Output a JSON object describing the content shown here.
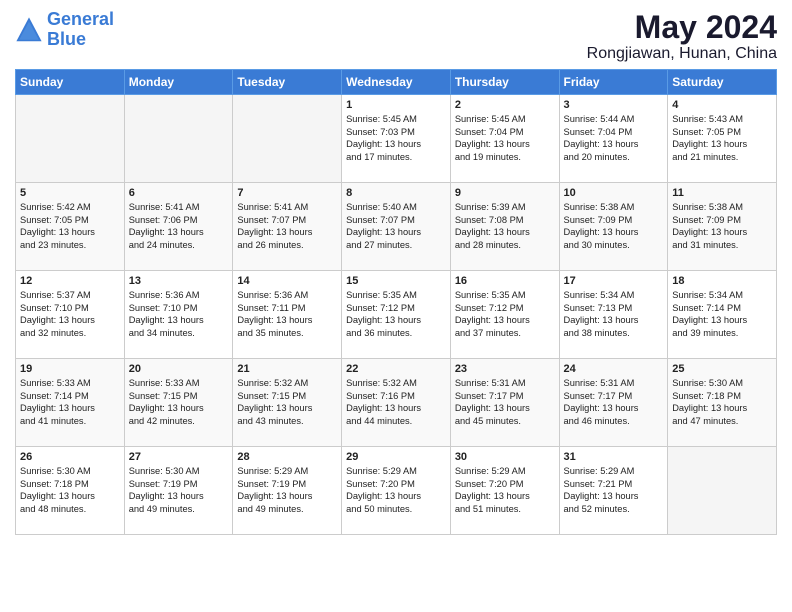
{
  "logo": {
    "line1": "General",
    "line2": "Blue"
  },
  "title": "May 2024",
  "location": "Rongjiawan, Hunan, China",
  "weekdays": [
    "Sunday",
    "Monday",
    "Tuesday",
    "Wednesday",
    "Thursday",
    "Friday",
    "Saturday"
  ],
  "weeks": [
    [
      {
        "day": "",
        "text": ""
      },
      {
        "day": "",
        "text": ""
      },
      {
        "day": "",
        "text": ""
      },
      {
        "day": "1",
        "text": "Sunrise: 5:45 AM\nSunset: 7:03 PM\nDaylight: 13 hours\nand 17 minutes."
      },
      {
        "day": "2",
        "text": "Sunrise: 5:45 AM\nSunset: 7:04 PM\nDaylight: 13 hours\nand 19 minutes."
      },
      {
        "day": "3",
        "text": "Sunrise: 5:44 AM\nSunset: 7:04 PM\nDaylight: 13 hours\nand 20 minutes."
      },
      {
        "day": "4",
        "text": "Sunrise: 5:43 AM\nSunset: 7:05 PM\nDaylight: 13 hours\nand 21 minutes."
      }
    ],
    [
      {
        "day": "5",
        "text": "Sunrise: 5:42 AM\nSunset: 7:05 PM\nDaylight: 13 hours\nand 23 minutes."
      },
      {
        "day": "6",
        "text": "Sunrise: 5:41 AM\nSunset: 7:06 PM\nDaylight: 13 hours\nand 24 minutes."
      },
      {
        "day": "7",
        "text": "Sunrise: 5:41 AM\nSunset: 7:07 PM\nDaylight: 13 hours\nand 26 minutes."
      },
      {
        "day": "8",
        "text": "Sunrise: 5:40 AM\nSunset: 7:07 PM\nDaylight: 13 hours\nand 27 minutes."
      },
      {
        "day": "9",
        "text": "Sunrise: 5:39 AM\nSunset: 7:08 PM\nDaylight: 13 hours\nand 28 minutes."
      },
      {
        "day": "10",
        "text": "Sunrise: 5:38 AM\nSunset: 7:09 PM\nDaylight: 13 hours\nand 30 minutes."
      },
      {
        "day": "11",
        "text": "Sunrise: 5:38 AM\nSunset: 7:09 PM\nDaylight: 13 hours\nand 31 minutes."
      }
    ],
    [
      {
        "day": "12",
        "text": "Sunrise: 5:37 AM\nSunset: 7:10 PM\nDaylight: 13 hours\nand 32 minutes."
      },
      {
        "day": "13",
        "text": "Sunrise: 5:36 AM\nSunset: 7:10 PM\nDaylight: 13 hours\nand 34 minutes."
      },
      {
        "day": "14",
        "text": "Sunrise: 5:36 AM\nSunset: 7:11 PM\nDaylight: 13 hours\nand 35 minutes."
      },
      {
        "day": "15",
        "text": "Sunrise: 5:35 AM\nSunset: 7:12 PM\nDaylight: 13 hours\nand 36 minutes."
      },
      {
        "day": "16",
        "text": "Sunrise: 5:35 AM\nSunset: 7:12 PM\nDaylight: 13 hours\nand 37 minutes."
      },
      {
        "day": "17",
        "text": "Sunrise: 5:34 AM\nSunset: 7:13 PM\nDaylight: 13 hours\nand 38 minutes."
      },
      {
        "day": "18",
        "text": "Sunrise: 5:34 AM\nSunset: 7:14 PM\nDaylight: 13 hours\nand 39 minutes."
      }
    ],
    [
      {
        "day": "19",
        "text": "Sunrise: 5:33 AM\nSunset: 7:14 PM\nDaylight: 13 hours\nand 41 minutes."
      },
      {
        "day": "20",
        "text": "Sunrise: 5:33 AM\nSunset: 7:15 PM\nDaylight: 13 hours\nand 42 minutes."
      },
      {
        "day": "21",
        "text": "Sunrise: 5:32 AM\nSunset: 7:15 PM\nDaylight: 13 hours\nand 43 minutes."
      },
      {
        "day": "22",
        "text": "Sunrise: 5:32 AM\nSunset: 7:16 PM\nDaylight: 13 hours\nand 44 minutes."
      },
      {
        "day": "23",
        "text": "Sunrise: 5:31 AM\nSunset: 7:17 PM\nDaylight: 13 hours\nand 45 minutes."
      },
      {
        "day": "24",
        "text": "Sunrise: 5:31 AM\nSunset: 7:17 PM\nDaylight: 13 hours\nand 46 minutes."
      },
      {
        "day": "25",
        "text": "Sunrise: 5:30 AM\nSunset: 7:18 PM\nDaylight: 13 hours\nand 47 minutes."
      }
    ],
    [
      {
        "day": "26",
        "text": "Sunrise: 5:30 AM\nSunset: 7:18 PM\nDaylight: 13 hours\nand 48 minutes."
      },
      {
        "day": "27",
        "text": "Sunrise: 5:30 AM\nSunset: 7:19 PM\nDaylight: 13 hours\nand 49 minutes."
      },
      {
        "day": "28",
        "text": "Sunrise: 5:29 AM\nSunset: 7:19 PM\nDaylight: 13 hours\nand 49 minutes."
      },
      {
        "day": "29",
        "text": "Sunrise: 5:29 AM\nSunset: 7:20 PM\nDaylight: 13 hours\nand 50 minutes."
      },
      {
        "day": "30",
        "text": "Sunrise: 5:29 AM\nSunset: 7:20 PM\nDaylight: 13 hours\nand 51 minutes."
      },
      {
        "day": "31",
        "text": "Sunrise: 5:29 AM\nSunset: 7:21 PM\nDaylight: 13 hours\nand 52 minutes."
      },
      {
        "day": "",
        "text": ""
      }
    ]
  ]
}
